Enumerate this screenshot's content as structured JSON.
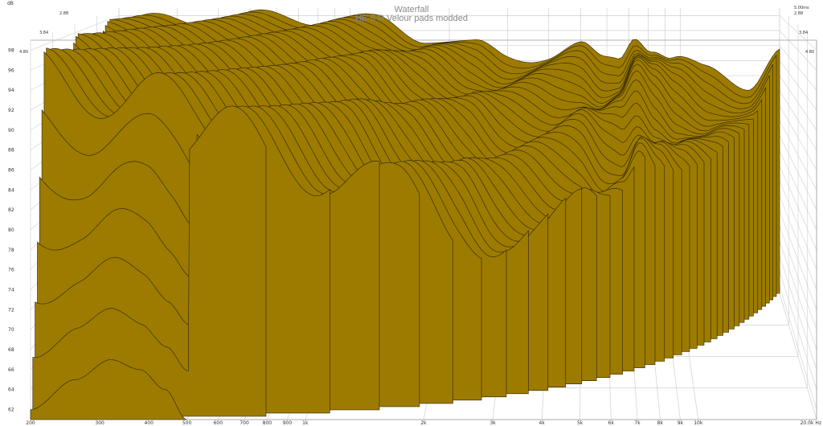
{
  "chart_data": {
    "type": "area",
    "title": "Waterfall",
    "subtitle": "HE-6 R Velour pads modded",
    "y_unit": "dB",
    "x_unit": "Hz",
    "x_scale": "log",
    "y_ticks": [
      62,
      64,
      66,
      68,
      70,
      72,
      74,
      76,
      78,
      80,
      82,
      84,
      86,
      88,
      90,
      92,
      94,
      96,
      98
    ],
    "ylim": [
      61,
      99
    ],
    "x_ticks": [
      {
        "value": 200,
        "label": "200"
      },
      {
        "value": 300,
        "label": "300"
      },
      {
        "value": 400,
        "label": "400"
      },
      {
        "value": 500,
        "label": "500"
      },
      {
        "value": 600,
        "label": "600"
      },
      {
        "value": 700,
        "label": "700"
      },
      {
        "value": 800,
        "label": "800"
      },
      {
        "value": 900,
        "label": "900"
      },
      {
        "value": 1000,
        "label": "1k"
      },
      {
        "value": 2000,
        "label": "2k"
      },
      {
        "value": 3000,
        "label": "3k"
      },
      {
        "value": 4000,
        "label": "4k"
      },
      {
        "value": 5000,
        "label": "5k"
      },
      {
        "value": 6000,
        "label": "6k"
      },
      {
        "value": 7000,
        "label": "7k"
      },
      {
        "value": 8000,
        "label": "8k"
      },
      {
        "value": 9000,
        "label": "9k"
      },
      {
        "value": 10000,
        "label": "10k"
      },
      {
        "value": 20000,
        "label": "20.0k Hz"
      }
    ],
    "xlim": [
      200,
      20000
    ],
    "time_labels": [
      "5.00ms",
      "2.88",
      "3.84",
      "4.80"
    ],
    "slice_count": 40,
    "front_slice": [
      {
        "f": 200,
        "db": 62
      },
      {
        "f": 260,
        "db": 65
      },
      {
        "f": 320,
        "db": 67
      },
      {
        "f": 380,
        "db": 66
      },
      {
        "f": 440,
        "db": 64
      },
      {
        "f": 500,
        "db": 61
      }
    ],
    "back_slice": [
      {
        "f": 200,
        "db": 97
      },
      {
        "f": 300,
        "db": 97.5
      },
      {
        "f": 400,
        "db": 97.6
      },
      {
        "f": 600,
        "db": 97.8
      },
      {
        "f": 900,
        "db": 97.6
      },
      {
        "f": 1200,
        "db": 97.2
      },
      {
        "f": 1700,
        "db": 95.3
      },
      {
        "f": 2400,
        "db": 93.8
      },
      {
        "f": 3000,
        "db": 92.6
      },
      {
        "f": 4000,
        "db": 92.8
      },
      {
        "f": 5000,
        "db": 93.6
      },
      {
        "f": 5800,
        "db": 92.0
      },
      {
        "f": 6500,
        "db": 92.4
      },
      {
        "f": 7300,
        "db": 95.8
      },
      {
        "f": 8200,
        "db": 94.0
      },
      {
        "f": 9500,
        "db": 92.2
      },
      {
        "f": 12000,
        "db": 90.5
      },
      {
        "f": 16000,
        "db": 89.0
      },
      {
        "f": 20000,
        "db": 93.5
      }
    ],
    "colors": {
      "fill": "#9c7b00",
      "stroke": "#2e2200",
      "grid": "#cfcfcf",
      "background": "#ffffff"
    },
    "grid": true
  }
}
